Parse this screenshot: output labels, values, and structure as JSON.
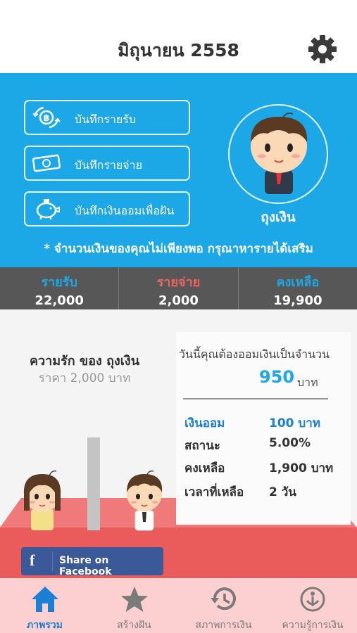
{
  "header": {
    "title": "มิถุนายน 2558"
  },
  "actions": [
    {
      "label": "บันทึกรายรับ"
    },
    {
      "label": "บันทึกรายจ่าย"
    },
    {
      "label": "บันทึกเงินออมเพื่อฝัน"
    }
  ],
  "avatar": {
    "name": "ถุงเงิน"
  },
  "warning": "* จำนวนเงินของคุณไม่เพียงพอ กรุณาหารายได้เสริม",
  "stats": {
    "income_label": "รายรับ",
    "income_value": "22,000",
    "expense_label": "รายจ่าย",
    "expense_value": "2,000",
    "balance_label": "คงเหลือ",
    "balance_value": "19,900"
  },
  "goal": {
    "title": "ความรัก ของ ถุงเงิน",
    "price": "ราคา 2,000 บาท"
  },
  "today": {
    "text": "วันนี้คุณต้องออมเงินเป็นจำนวน",
    "amount": "950",
    "unit": "บาท"
  },
  "details": [
    {
      "key": "เงินออม",
      "value": "100 บาท"
    },
    {
      "key": "สถานะ",
      "value": "5.00%"
    },
    {
      "key": "คงเหลือ",
      "value": "1,900 บาท"
    },
    {
      "key": "เวลาที่เหลือ",
      "value": "2 วัน"
    }
  ],
  "facebook": {
    "label": "Share on Facebook"
  },
  "tabs": [
    {
      "label": "ภาพรวม",
      "icon": "home-icon",
      "active": true
    },
    {
      "label": "สร้างฝัน",
      "icon": "star-icon",
      "active": false
    },
    {
      "label": "สภาพการเงิน",
      "icon": "history-icon",
      "active": false
    },
    {
      "label": "ความรู้การเงิน",
      "icon": "knowledge-icon",
      "active": false
    }
  ],
  "colors": {
    "accent": "#1ca8e6",
    "expense": "#ef6262",
    "facebook": "#3b5998",
    "tabbar": "#fcd0d0"
  }
}
